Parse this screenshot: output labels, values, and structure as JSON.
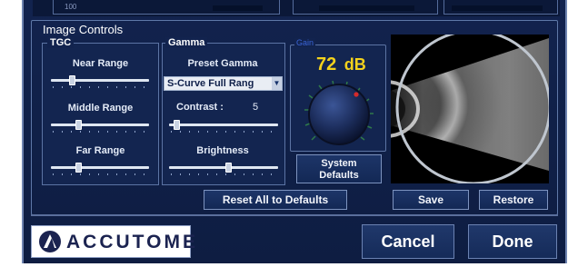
{
  "panel": {
    "title": "Image Controls"
  },
  "tgc": {
    "title": "TGC",
    "near_label": "Near Range",
    "middle_label": "Middle Range",
    "far_label": "Far Range",
    "near_level": 0.2,
    "middle_level": 0.27,
    "far_level": 0.27
  },
  "gamma": {
    "title": "Gamma",
    "preset_label": "Preset Gamma",
    "preset_value": "S-Curve  Full Rang",
    "contrast_label": "Contrast :",
    "contrast_value": "5",
    "contrast_level": 0.04,
    "brightness_label": "Brightness",
    "brightness_level": 0.55
  },
  "gain": {
    "label": "Gain",
    "value": "72",
    "unit": "dB",
    "knob_indicator_color": "#d42a2a",
    "value_color": "#f3d21c"
  },
  "buttons": {
    "system_defaults_line1": "System",
    "system_defaults_line2": "Defaults",
    "reset_all": "Reset All to Defaults",
    "save": "Save",
    "restore": "Restore",
    "cancel": "Cancel",
    "done": "Done"
  },
  "logo": {
    "text": "ACCUTOME",
    "icon": "accutome-logo-icon"
  },
  "preview": {
    "image": "ultrasound-b-scan-preview"
  },
  "top_strip": {
    "partial_text": "100"
  }
}
